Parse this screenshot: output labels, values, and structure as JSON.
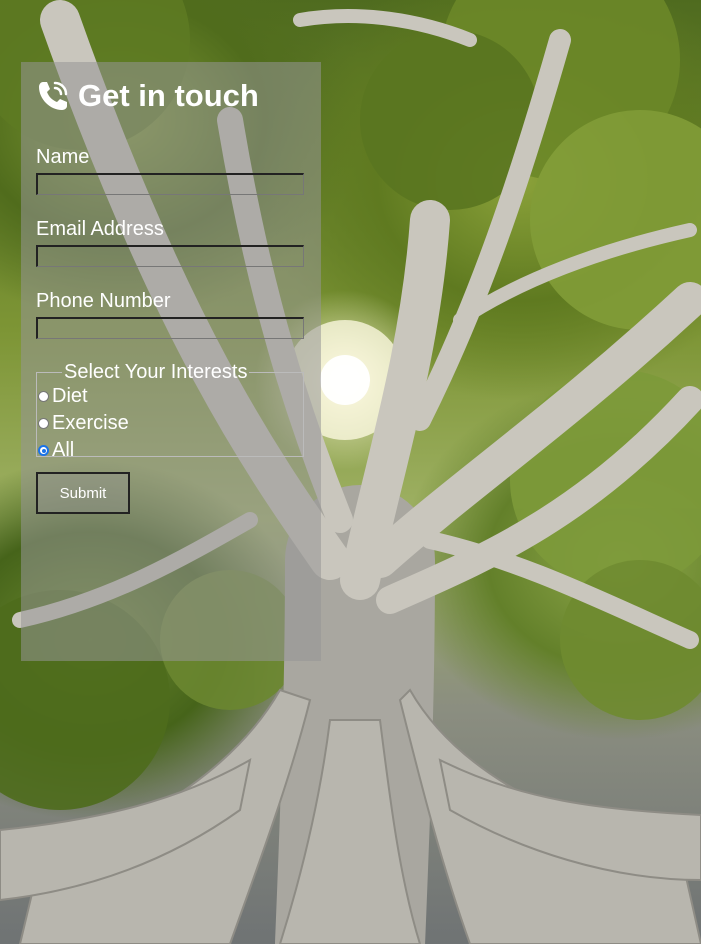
{
  "form": {
    "title": "Get in touch",
    "title_icon": "phone-call-icon",
    "fields": [
      {
        "label": "Name",
        "value": ""
      },
      {
        "label": "Email Address",
        "value": ""
      },
      {
        "label": "Phone Number",
        "value": ""
      }
    ],
    "interests": {
      "legend": "Select Your Interests",
      "options": [
        {
          "label": "Diet",
          "checked": false
        },
        {
          "label": "Exercise",
          "checked": false
        },
        {
          "label": "All",
          "checked": true
        }
      ]
    },
    "submit_label": "Submit"
  },
  "colors": {
    "panel_bg": "#969696",
    "text": "#ffffff",
    "radio_checked": "#1a73e8"
  }
}
